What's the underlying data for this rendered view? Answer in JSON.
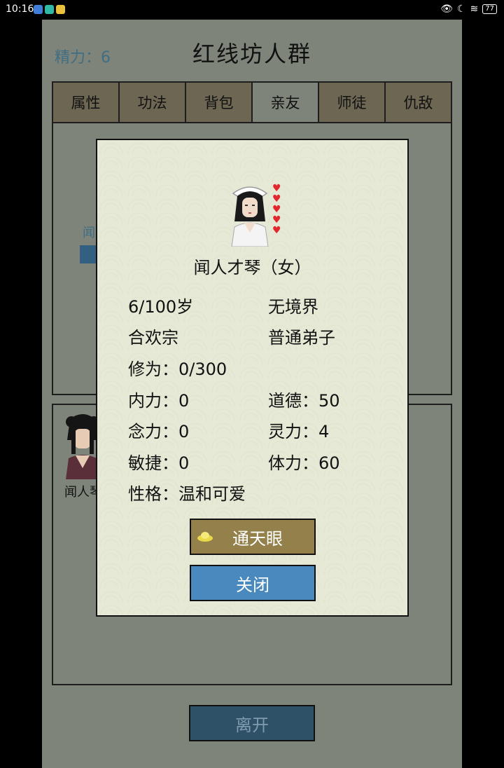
{
  "status_bar": {
    "time": "10:16",
    "battery": "77",
    "notification_colors": [
      "#3f7fd8",
      "#2fb9a6",
      "#e9c13d"
    ]
  },
  "header": {
    "energy_label": "精力：6",
    "title": "红线坊人群"
  },
  "tabs": [
    {
      "label": "属性",
      "active": false
    },
    {
      "label": "功法",
      "active": false
    },
    {
      "label": "背包",
      "active": false
    },
    {
      "label": "亲友",
      "active": true
    },
    {
      "label": "师徒",
      "active": false
    },
    {
      "label": "仇敌",
      "active": false
    }
  ],
  "background": {
    "npc1_label_fragment": "闻",
    "npc2_label_fragment": "闻人琴"
  },
  "leave_button": "离开",
  "dialog": {
    "name": "闻人才琴（女）",
    "hearts": 5,
    "stats": {
      "age": "6/100岁",
      "realm": "无境界",
      "sect": "合欢宗",
      "rank": "普通弟子",
      "cultivation": "修为：0/300",
      "inner_power": "内力：0",
      "morality": "道德：50",
      "mind_power": "念力：0",
      "spirit_power": "灵力：4",
      "agility": "敏捷：0",
      "stamina": "体力：60",
      "personality": "性格：温和可爱"
    },
    "eye_button": "通天眼",
    "close_button": "关闭"
  },
  "colors": {
    "screen_bg": "#7f847a",
    "tab_bg": "#6d6653",
    "dialog_bg": "#e6e9d6",
    "eye_button_bg": "#94804a",
    "close_button_bg": "#4a89bd",
    "leave_button_bg": "#2f5168"
  }
}
